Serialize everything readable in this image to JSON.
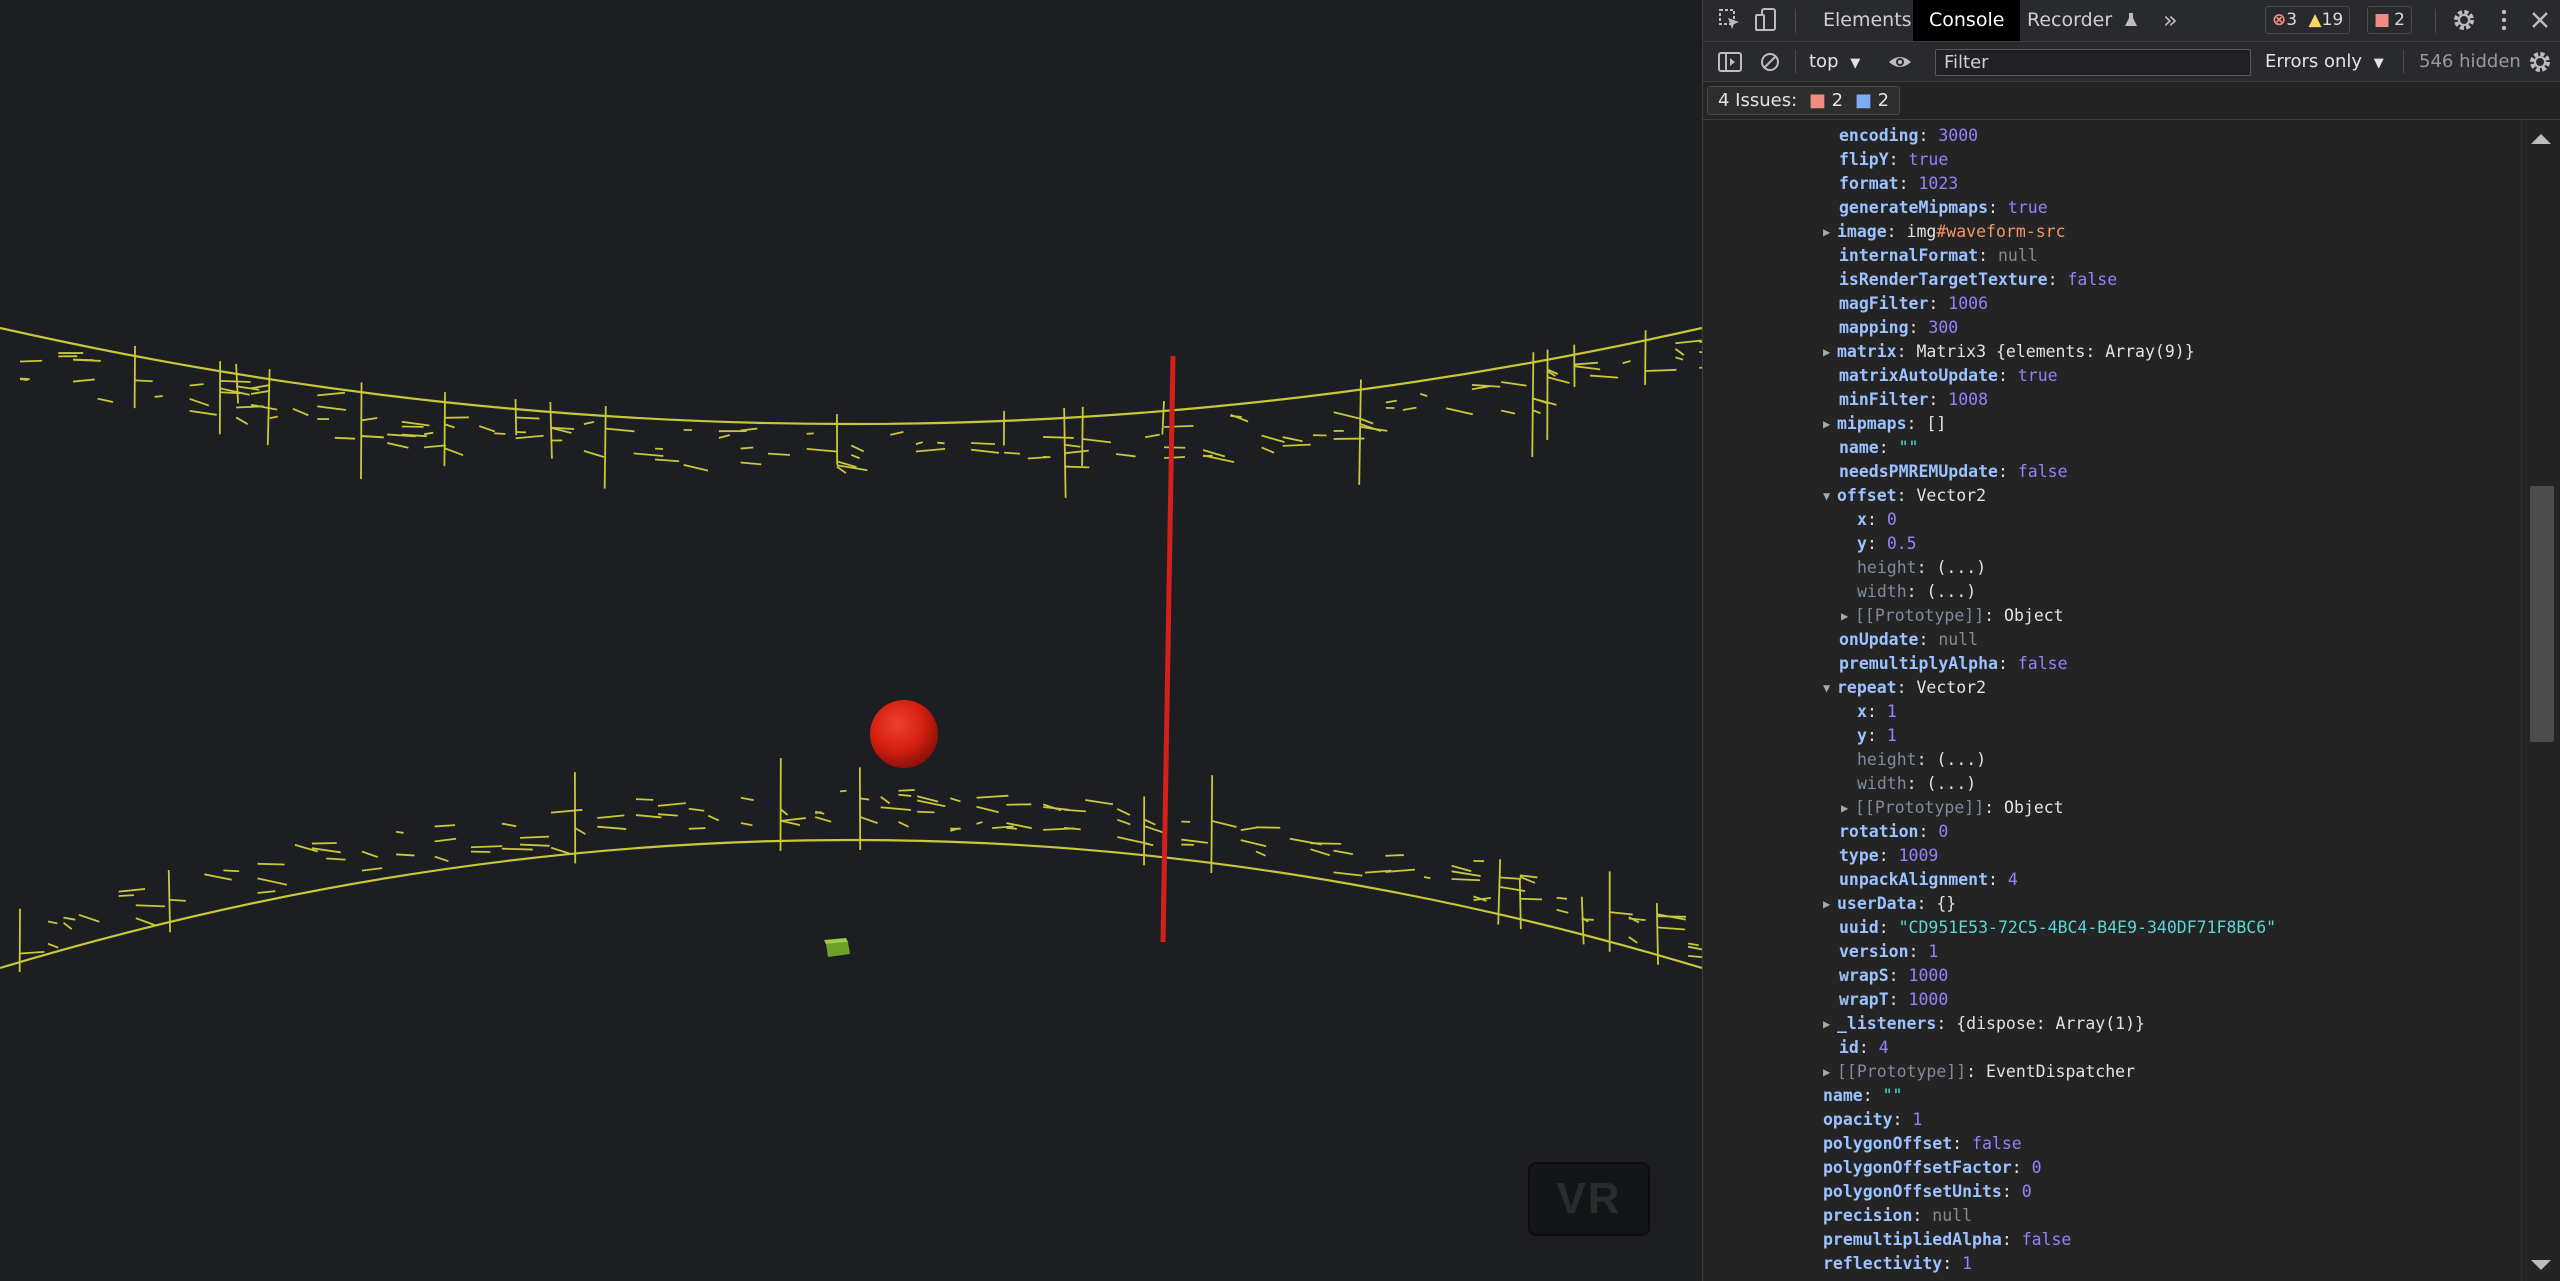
{
  "viewport": {
    "vr_label": "VR",
    "colors": {
      "background": "#1d1e21",
      "grid_line": "#c8c83a",
      "sphere": "#d51f10",
      "pole": "#d4201a",
      "cube": "#6fa02a"
    }
  },
  "devtools": {
    "tabs": [
      "Elements",
      "Console",
      "Recorder"
    ],
    "active_tab": "Console",
    "more_tabs_glyph": "»",
    "counts": {
      "errors": "3",
      "warnings": "19",
      "issues": "2"
    },
    "toolbar": {
      "context": "top",
      "filter_placeholder": "Filter",
      "levels": "Errors only",
      "hidden": "546 hidden"
    },
    "issues_bar": {
      "label": "4 Issues:",
      "red_count": "2",
      "blue_count": "2"
    },
    "properties": [
      {
        "indent": 1,
        "key": "encoding",
        "value": "3000",
        "vtype": "num"
      },
      {
        "indent": 1,
        "key": "flipY",
        "value": "true",
        "vtype": "bool"
      },
      {
        "indent": 1,
        "key": "format",
        "value": "1023",
        "vtype": "num"
      },
      {
        "indent": 1,
        "key": "generateMipmaps",
        "value": "true",
        "vtype": "bool"
      },
      {
        "indent": 1,
        "key": "image",
        "value": "img",
        "value2": "#waveform-src",
        "vtype": "selector",
        "expander": "collapsed"
      },
      {
        "indent": 1,
        "key": "internalFormat",
        "value": "null",
        "vtype": "nul"
      },
      {
        "indent": 1,
        "key": "isRenderTargetTexture",
        "value": "false",
        "vtype": "bool"
      },
      {
        "indent": 1,
        "key": "magFilter",
        "value": "1006",
        "vtype": "num"
      },
      {
        "indent": 1,
        "key": "mapping",
        "value": "300",
        "vtype": "num"
      },
      {
        "indent": 1,
        "key": "matrix",
        "value": "Matrix3 {elements: Array(9)}",
        "vtype": "obj",
        "expander": "collapsed"
      },
      {
        "indent": 1,
        "key": "matrixAutoUpdate",
        "value": "true",
        "vtype": "bool"
      },
      {
        "indent": 1,
        "key": "minFilter",
        "value": "1008",
        "vtype": "num"
      },
      {
        "indent": 1,
        "key": "mipmaps",
        "value": "[]",
        "vtype": "obj",
        "expander": "collapsed"
      },
      {
        "indent": 1,
        "key": "name",
        "value": "\"\"",
        "vtype": "str"
      },
      {
        "indent": 1,
        "key": "needsPMREMUpdate",
        "value": "false",
        "vtype": "bool"
      },
      {
        "indent": 1,
        "key": "offset",
        "value": "Vector2",
        "vtype": "obj",
        "expander": "expanded"
      },
      {
        "indent": 2,
        "key": "x",
        "value": "0",
        "vtype": "num"
      },
      {
        "indent": 2,
        "key": "y",
        "value": "0.5",
        "vtype": "num"
      },
      {
        "indent": 2,
        "key": "height",
        "value": "(...)",
        "vtype": "obj",
        "dim": true
      },
      {
        "indent": 2,
        "key": "width",
        "value": "(...)",
        "vtype": "obj",
        "dim": true
      },
      {
        "indent": 2,
        "key": "[[Prototype]]",
        "value": "Object",
        "vtype": "obj",
        "dim": true,
        "expander": "collapsed"
      },
      {
        "indent": 1,
        "key": "onUpdate",
        "value": "null",
        "vtype": "nul"
      },
      {
        "indent": 1,
        "key": "premultiplyAlpha",
        "value": "false",
        "vtype": "bool"
      },
      {
        "indent": 1,
        "key": "repeat",
        "value": "Vector2",
        "vtype": "obj",
        "expander": "expanded"
      },
      {
        "indent": 2,
        "key": "x",
        "value": "1",
        "vtype": "num"
      },
      {
        "indent": 2,
        "key": "y",
        "value": "1",
        "vtype": "num"
      },
      {
        "indent": 2,
        "key": "height",
        "value": "(...)",
        "vtype": "obj",
        "dim": true
      },
      {
        "indent": 2,
        "key": "width",
        "value": "(...)",
        "vtype": "obj",
        "dim": true
      },
      {
        "indent": 2,
        "key": "[[Prototype]]",
        "value": "Object",
        "vtype": "obj",
        "dim": true,
        "expander": "collapsed"
      },
      {
        "indent": 1,
        "key": "rotation",
        "value": "0",
        "vtype": "num"
      },
      {
        "indent": 1,
        "key": "type",
        "value": "1009",
        "vtype": "num"
      },
      {
        "indent": 1,
        "key": "unpackAlignment",
        "value": "4",
        "vtype": "num"
      },
      {
        "indent": 1,
        "key": "userData",
        "value": "{}",
        "vtype": "obj",
        "expander": "collapsed"
      },
      {
        "indent": 1,
        "key": "uuid",
        "value": "\"CD951E53-72C5-4BC4-B4E9-340DF71F8BC6\"",
        "vtype": "str"
      },
      {
        "indent": 1,
        "key": "version",
        "value": "1",
        "vtype": "num"
      },
      {
        "indent": 1,
        "key": "wrapS",
        "value": "1000",
        "vtype": "num"
      },
      {
        "indent": 1,
        "key": "wrapT",
        "value": "1000",
        "vtype": "num"
      },
      {
        "indent": 1,
        "key": "_listeners",
        "value": "{dispose: Array(1)}",
        "vtype": "obj",
        "expander": "collapsed"
      },
      {
        "indent": 1,
        "key": "id",
        "value": "4",
        "vtype": "num"
      },
      {
        "indent": 1,
        "key": "[[Prototype]]",
        "value": "EventDispatcher",
        "vtype": "obj",
        "dim": true,
        "expander": "collapsed"
      },
      {
        "indent": 0,
        "key": "name",
        "value": "\"\"",
        "vtype": "str"
      },
      {
        "indent": 0,
        "key": "opacity",
        "value": "1",
        "vtype": "num"
      },
      {
        "indent": 0,
        "key": "polygonOffset",
        "value": "false",
        "vtype": "bool"
      },
      {
        "indent": 0,
        "key": "polygonOffsetFactor",
        "value": "0",
        "vtype": "num"
      },
      {
        "indent": 0,
        "key": "polygonOffsetUnits",
        "value": "0",
        "vtype": "num"
      },
      {
        "indent": 0,
        "key": "precision",
        "value": "null",
        "vtype": "nul"
      },
      {
        "indent": 0,
        "key": "premultipliedAlpha",
        "value": "false",
        "vtype": "bool"
      },
      {
        "indent": 0,
        "key": "reflectivity",
        "value": "1",
        "vtype": "num"
      }
    ]
  }
}
